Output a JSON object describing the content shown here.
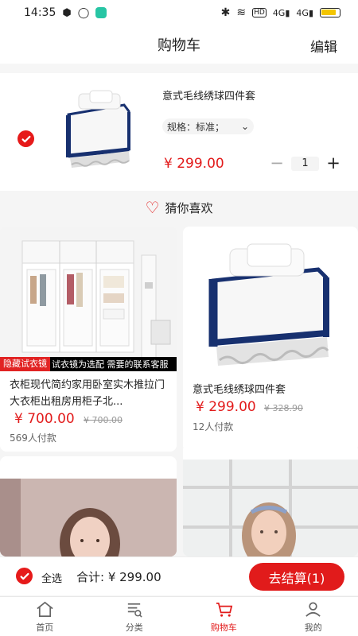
{
  "status_bar": {
    "time": "14:35",
    "indicators": [
      "bluetooth-icon",
      "wifi-icon",
      "hd-icon",
      "signal-icon",
      "signal-icon",
      "battery-icon"
    ],
    "signal_label_1": "4G",
    "signal_label_2": "4G",
    "battery_color": "#f3c500"
  },
  "header": {
    "title": "购物车",
    "edit_label": "编辑"
  },
  "cart": {
    "item": {
      "checked": true,
      "title": "意式毛线绣球四件套",
      "spec": "规格：标准；",
      "price": "¥ 299.00",
      "quantity": "1"
    }
  },
  "recommendations": {
    "title": "猜你喜欢",
    "products": [
      {
        "caption_badge": "隐藏试衣镜",
        "caption_text": "试衣镜为选配 需要的联系客服",
        "name": "衣柜现代简约家用卧室实木推拉门大衣柜出租房用柜子北...",
        "price": "¥ 700.00",
        "old_price": "¥ 700.00",
        "sold": "569人付款"
      },
      {
        "name": "意式毛线绣球四件套",
        "price": "¥ 299.00",
        "old_price": "¥ 328.90",
        "sold": "12人付款"
      }
    ]
  },
  "checkout": {
    "select_all": "全选",
    "total": "合计: ¥ 299.00",
    "button": "去结算(1)"
  },
  "tabs": [
    {
      "label": "首页",
      "icon": "home-icon",
      "active": false
    },
    {
      "label": "分类",
      "icon": "category-icon",
      "active": false
    },
    {
      "label": "购物车",
      "icon": "cart-icon",
      "active": true
    },
    {
      "label": "我的",
      "icon": "profile-icon",
      "active": false
    }
  ],
  "accent_color": "#e21b1b"
}
